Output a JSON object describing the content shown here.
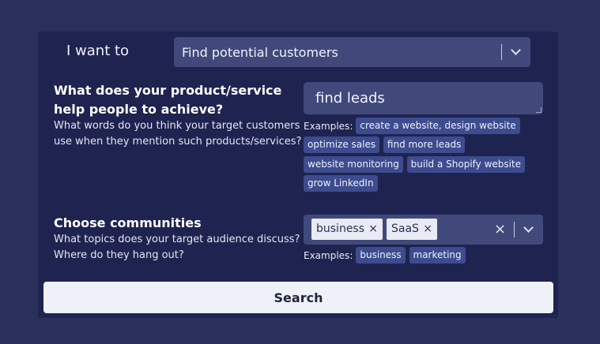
{
  "intent": {
    "label": "I want to",
    "selected": "Find potential customers"
  },
  "achieve": {
    "title_line1": "What does your product/service",
    "title_line2": "help people to achieve?",
    "desc_line1": "What words do you think your target customers",
    "desc_line2": "use when they mention such products/services?",
    "input_value": "find leads",
    "examples_label": "Examples:",
    "examples": [
      "create a website, design website",
      "optimize sales",
      "find more leads",
      "website monitoring",
      "build a Shopify website",
      "grow LinkedIn"
    ]
  },
  "communities": {
    "title": "Choose communities",
    "desc_line1": "What topics does your target audience discuss?",
    "desc_line2": "Where do they hang out?",
    "selected": [
      "business",
      "SaaS"
    ],
    "examples_label": "Examples:",
    "examples": [
      "business",
      "marketing"
    ]
  },
  "search_label": "Search",
  "icons": {
    "chip_remove": "×",
    "clear": "×"
  }
}
